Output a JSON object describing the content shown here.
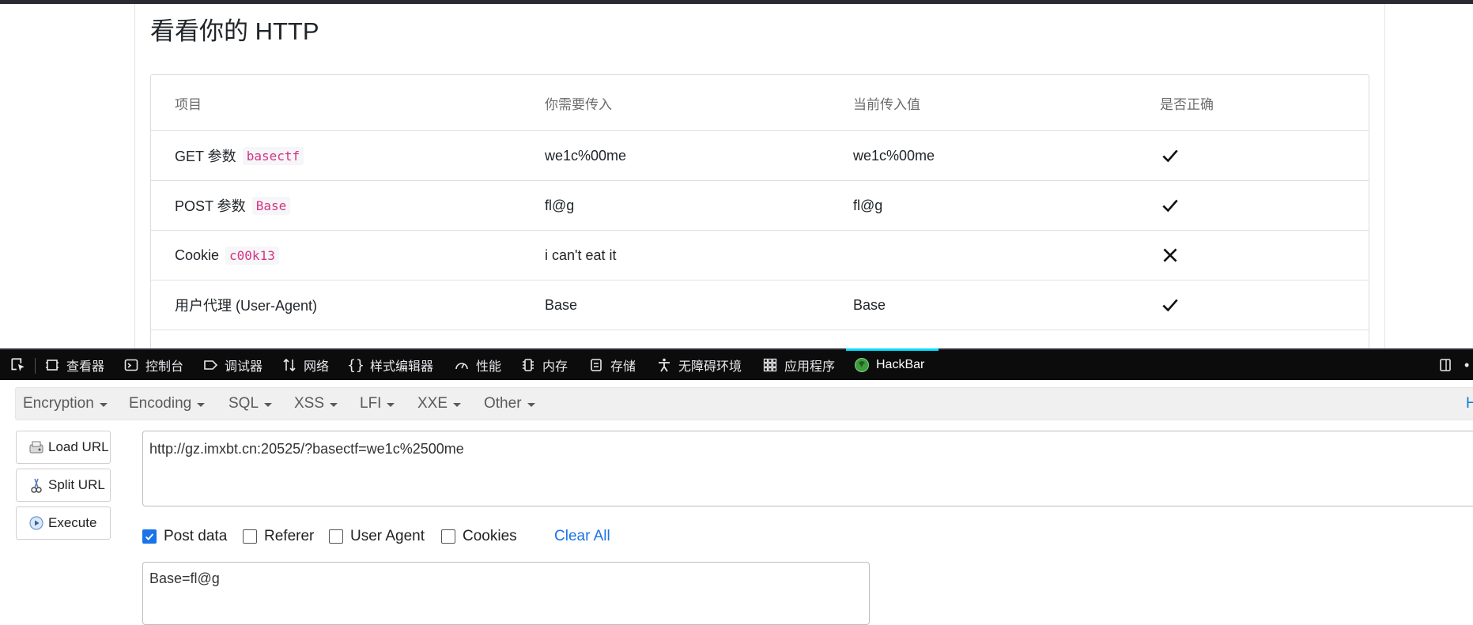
{
  "page": {
    "title": "看看你的 HTTP",
    "table": {
      "headers": [
        "项目",
        "你需要传入",
        "当前传入值",
        "是否正确"
      ],
      "rows": [
        {
          "item": "GET 参数",
          "code": "basectf",
          "required": "we1c%00me",
          "current": "we1c%00me",
          "correct": true
        },
        {
          "item": "POST 参数",
          "code": "Base",
          "required": "fl@g",
          "current": "fl@g",
          "correct": true
        },
        {
          "item": "Cookie",
          "code": "c00k13",
          "required": "i can't eat it",
          "current": "",
          "correct": false
        },
        {
          "item": "用户代理 (User-Agent)",
          "code": "",
          "required": "Base",
          "current": "Base",
          "correct": true
        }
      ]
    }
  },
  "devtools": {
    "tabs": [
      {
        "label": "查看器",
        "icon": "inspector-icon"
      },
      {
        "label": "控制台",
        "icon": "console-icon"
      },
      {
        "label": "调试器",
        "icon": "debugger-icon"
      },
      {
        "label": "网络",
        "icon": "network-icon"
      },
      {
        "label": "样式编辑器",
        "icon": "style-editor-icon"
      },
      {
        "label": "性能",
        "icon": "performance-icon"
      },
      {
        "label": "内存",
        "icon": "memory-icon"
      },
      {
        "label": "存储",
        "icon": "storage-icon"
      },
      {
        "label": "无障碍环境",
        "icon": "accessibility-icon"
      },
      {
        "label": "应用程序",
        "icon": "application-icon"
      },
      {
        "label": "HackBar",
        "icon": "hackbar-icon",
        "active": true
      }
    ],
    "accent": "#00ddff"
  },
  "hackbar": {
    "menu": [
      "Encryption",
      "Encoding",
      "SQL",
      "XSS",
      "LFI",
      "XXE",
      "Other"
    ],
    "menu_right": "H",
    "buttons": {
      "load": "Load URL",
      "split": "Split URL",
      "execute": "Execute"
    },
    "url": "http://gz.imxbt.cn:20525/?basectf=we1c%2500me",
    "options": {
      "post_data": {
        "label": "Post data",
        "checked": true
      },
      "referer": {
        "label": "Referer",
        "checked": false
      },
      "user_agent": {
        "label": "User Agent",
        "checked": false
      },
      "cookies": {
        "label": "Cookies",
        "checked": false
      }
    },
    "clear_all": "Clear All",
    "post_body": "Base=fl@g",
    "accent": "#1a73e8"
  }
}
